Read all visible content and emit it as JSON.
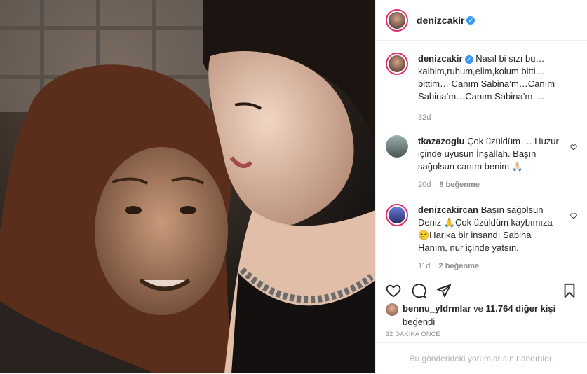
{
  "author": {
    "username": "denizcakir",
    "verified": true
  },
  "caption": {
    "username": "denizcakir",
    "text": "Nasıl bi sızı bu… kalbim,ruhum,elim,kolum bitti… bittim… Canım Sabina’m…Canım Sabina’m…Canım Sabina’m….",
    "age": "32d"
  },
  "comments": [
    {
      "username": "tkazazoglu",
      "text": "Çok üzüldüm…. Huzur içinde uyusun İnşallah. Başın sağolsun canım benim 🙏🏻",
      "age": "20d",
      "likes": "8 beğenme"
    },
    {
      "username": "denizcakircan",
      "text": "Başın sağolsun Deniz 🙏Çok üzüldüm kaybımıza 😢Harika bir insandı Sabina Hanım, nur içinde yatsın.",
      "age": "11d",
      "likes": "2 beğenme"
    }
  ],
  "likes": {
    "liker": "bennu_yldrmlar",
    "connector": "ve",
    "others": "11.764 diğer kişi",
    "suffix": "beğendi"
  },
  "posted_time": "32 DAKİKA ÖNCE",
  "restricted_text": "Bu gönderideki yorumlar sınırlandırıldı.",
  "icons": [
    "heart-icon",
    "comment-icon",
    "share-icon",
    "bookmark-icon",
    "verified-badge-icon"
  ],
  "colors": {
    "story_ring": "#e1306c",
    "verified": "#3897f0",
    "muted": "#8e8e8e"
  }
}
